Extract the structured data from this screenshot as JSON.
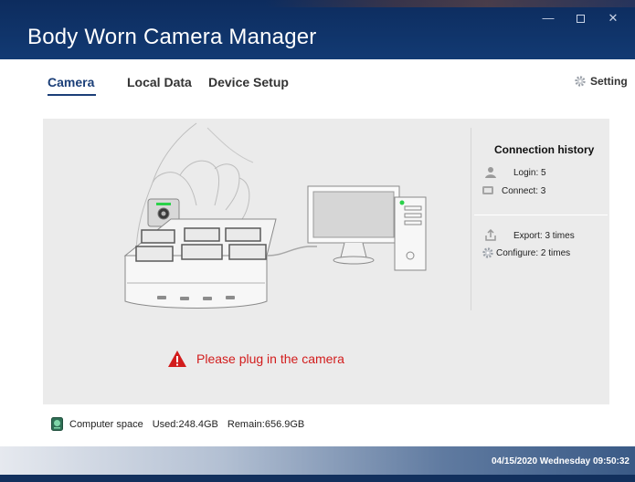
{
  "app": {
    "title": "Body Worn Camera Manager"
  },
  "window_controls": {
    "minimize": "—",
    "close": "✕"
  },
  "tabs": [
    {
      "label": "Camera",
      "active": true
    },
    {
      "label": "Local Data",
      "active": false
    },
    {
      "label": "Device Setup",
      "active": false
    }
  ],
  "setting": {
    "label": "Setting",
    "icon": "gear-icon"
  },
  "history": {
    "title": "Connection history",
    "login": "Login: 5",
    "connect": "Connect: 3",
    "export": "Export: 3 times",
    "configure": "Configure: 2 times"
  },
  "message": {
    "text": "Please plug in the camera",
    "icon": "warning-icon",
    "color": "#d21c1c"
  },
  "disk": {
    "label": "Computer space",
    "used": "Used:248.4GB",
    "remain": "Remain:656.9GB"
  },
  "status": {
    "datetime": "04/15/2020 Wednesday 09:50:32"
  },
  "colors": {
    "titlebar": "#123a73",
    "active_tab": "#1b3f78",
    "panel": "#ebebeb"
  }
}
